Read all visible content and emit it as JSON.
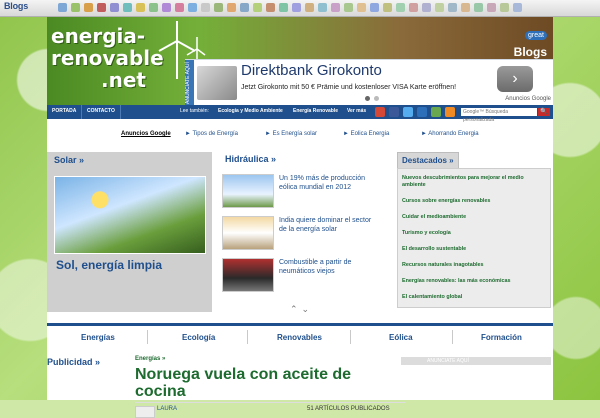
{
  "topbar": {
    "blogs_logo": "Blogs",
    "icon_colors": [
      "#7fa7d6",
      "#9ac26a",
      "#d8a04a",
      "#c25d5d",
      "#8f8fd1",
      "#6fbdbd",
      "#d9c15a",
      "#8bc18b",
      "#b08ad6",
      "#d67e9d",
      "#7db0e0",
      "#c9c9c9",
      "#9bb87a",
      "#e0a870",
      "#88a8c8",
      "#b5d07a",
      "#c58f6f",
      "#7fc4a4",
      "#a0a0e0",
      "#d0b080",
      "#90c0d0",
      "#c8a0c8",
      "#a8c890",
      "#e0c090",
      "#90a8e0",
      "#c0c080",
      "#a0d0b0",
      "#d0a0a0",
      "#b0b0d0",
      "#c0d0a0",
      "#a0b8c8",
      "#d8b890",
      "#98c8a8",
      "#c8a8b8",
      "#b8c898",
      "#a8b8d8"
    ]
  },
  "header": {
    "logo_line1": "energia-",
    "logo_line2": "renovable",
    "logo_line3": ".net",
    "great_badge": "great",
    "blogs_text": "Blogs"
  },
  "ad": {
    "anunciate": "ANUNCIATE AQUÍ",
    "title": "Direktbank Girokonto",
    "text": "Jetzt Girokonto mit 50 € Prämie und kostenloser VISA Karte eröffnen!",
    "arrow": "›",
    "google": "Anuncios Google"
  },
  "nav": {
    "portada": "PORTADA",
    "contacto": "CONTACTO",
    "lee_tambien": "Lee también:",
    "ecologia": "Ecología y Medio Ambiente",
    "energia_renovable": "Energía Renovable",
    "ver_mas": "Ver más",
    "search_placeholder": "Google™ Búsqueda personalizada",
    "search_btn": "🔍",
    "social_colors": [
      "#d34836",
      "#3b5998",
      "#55acee",
      "#2d6fb8",
      "#6aa84f",
      "#f08a24"
    ]
  },
  "adlinks": {
    "label": "Anuncios Google",
    "items": [
      "► Tipos de Energía",
      "► Es Energía solar",
      "► Eolica Energia",
      "► Ahorrando Energia"
    ]
  },
  "solar": {
    "title": "Solar »",
    "caption": "Sol, energía limpia"
  },
  "hidraulica": {
    "title": "Hidráulica »",
    "items": [
      {
        "text": "Un 19% más de producción eólica mundial en 2012"
      },
      {
        "text": "India quiere dominar el sector de la energía solar"
      },
      {
        "text": "Combustible a partir de neumáticos viejos"
      }
    ],
    "arrows": "⌃⌄"
  },
  "destacados": {
    "title": "Destacados »",
    "links": [
      "Nuevos descubrimientos para mejorar el medio ambiente",
      "Cursos sobre energías renovables",
      "Cuidar el medioambiente",
      "Turismo y ecología",
      "El desarrollo sustentable",
      "Recursos naturales inagotables",
      "Energías renovables: las más económicas",
      "El calentamiento global"
    ]
  },
  "categories": [
    "Energías",
    "Ecología",
    "Renovables",
    "Eólica",
    "Formación"
  ],
  "publicidad": "Publicidad »",
  "article": {
    "crumb": "Energías »",
    "title": "Noruega vuela con aceite de cocina",
    "author": "LAURA",
    "count": "51 ARTÍCULOS PUBLICADOS"
  },
  "anunciate_aqui": "ANUNCIATE AQUÍ"
}
